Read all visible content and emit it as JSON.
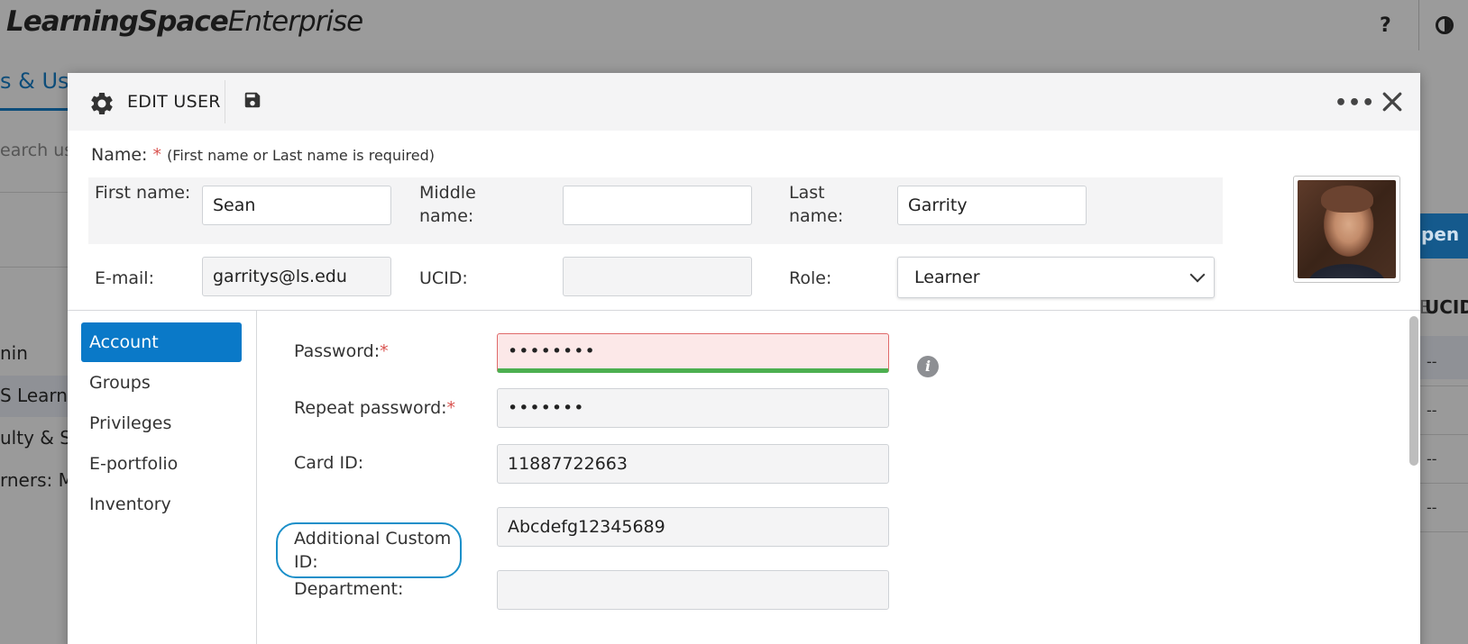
{
  "app": {
    "logo_bold": "LearningSpace",
    "logo_light": "Enterprise",
    "help_label": "?"
  },
  "background": {
    "tab_label": "s & Use",
    "search_placeholder": "earch use",
    "left_items": [
      "nin",
      "S Learner",
      "ulty & Sta",
      "rners: Mo"
    ],
    "open_button_label": "pen",
    "column_separator": "E",
    "column_header": "UCID",
    "row_values": [
      "--",
      "--",
      "--",
      "--"
    ]
  },
  "modal": {
    "title": "EDIT USER",
    "more_label": "•••",
    "name_section": {
      "label": "Name:",
      "required_mark": "*",
      "hint": "(First name or Last name is required)"
    },
    "fields": {
      "first_name": {
        "label": "First name:",
        "value": "Sean"
      },
      "middle_name": {
        "label": "Middle name:",
        "value": ""
      },
      "last_name": {
        "label": "Last name:",
        "value": "Garrity"
      },
      "email": {
        "label": "E-mail:",
        "value": "garritys@ls.edu"
      },
      "ucid": {
        "label": "UCID:",
        "value": ""
      },
      "role": {
        "label": "Role:",
        "value": "Learner"
      }
    },
    "nav": {
      "items": [
        "Account",
        "Groups",
        "Privileges",
        "E-portfolio",
        "Inventory"
      ],
      "active": "Account"
    },
    "account": {
      "password": {
        "label": "Password:",
        "required_mark": "*",
        "value": "••••••••"
      },
      "repeat_password": {
        "label": "Repeat password:",
        "required_mark": "*",
        "value": "•••••••"
      },
      "card_id": {
        "label": "Card ID:",
        "value": "11887722663"
      },
      "additional_custom_id": {
        "label": "Additional Custom ID:",
        "value": "Abcdefg12345689"
      },
      "department": {
        "label": "Department:",
        "value": ""
      }
    },
    "colors": {
      "accent": "#0a79c8",
      "error_bg": "#fce8e8",
      "strength_bar": "#4caf50",
      "required": "#d9534f"
    }
  }
}
